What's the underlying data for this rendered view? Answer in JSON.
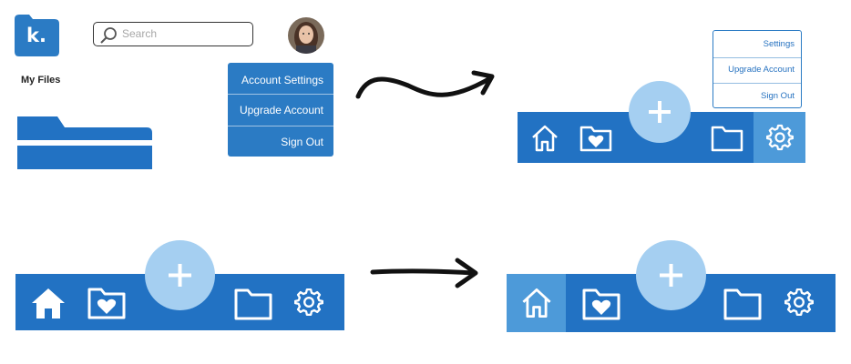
{
  "header": {
    "logo_text": "k.",
    "search_placeholder": "Search",
    "avatar": "user-avatar"
  },
  "sidebar": {
    "my_files_label": "My Files"
  },
  "account_menu_v1": {
    "items": [
      "Account Settings",
      "Upgrade Account",
      "Sign Out"
    ]
  },
  "account_menu_v2": {
    "items": [
      "Settings",
      "Upgrade Account",
      "Sign Out"
    ]
  },
  "fab": {
    "symbol": "+"
  },
  "nav_icons": [
    "home-icon",
    "favorites-folder-icon",
    "add-button",
    "folder-icon",
    "gear-icon"
  ],
  "colors": {
    "bar": "#2272c3",
    "fab": "#a5cff1",
    "active_tab": "#4d9ad9",
    "logo": "#2b7bc4"
  }
}
